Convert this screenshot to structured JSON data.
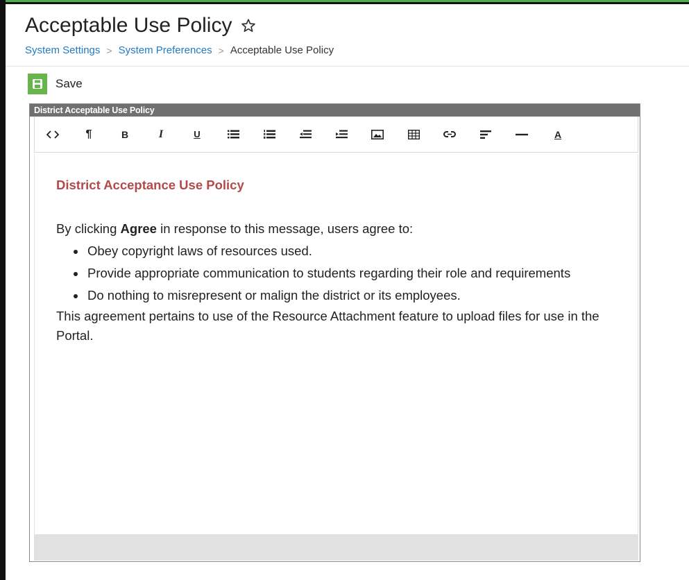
{
  "page": {
    "title": "Acceptable Use Policy"
  },
  "breadcrumb": {
    "items": [
      "System Settings",
      "System Preferences"
    ],
    "current": "Acceptable Use Policy"
  },
  "toolbar": {
    "save_label": "Save"
  },
  "editor": {
    "header": "District Acceptable Use Policy",
    "tools": [
      "code-view",
      "paragraph",
      "bold",
      "italic",
      "underline",
      "bullet-list",
      "numbered-list",
      "outdent",
      "indent",
      "image",
      "table",
      "link",
      "align",
      "horizontal-rule",
      "font-color"
    ],
    "tool_glyphs": {
      "paragraph": "¶",
      "bold": "B",
      "italic": "I",
      "underline": "U",
      "font_color": "A"
    }
  },
  "content": {
    "heading": "District Acceptance Use Policy",
    "intro_before": "By clicking ",
    "intro_bold": "Agree",
    "intro_after": " in response to this message, users agree to:",
    "bullets": [
      "Obey copyright laws of resources used.",
      "Provide appropriate communication to students regarding their role and requirements",
      "Do nothing to misrepresent or malign the district or its employees."
    ],
    "closing": "This agreement pertains to use of the Resource Attachment feature to upload files for use in the Portal."
  },
  "colors": {
    "save_green": "#68b44d",
    "link_blue": "#1f7bc4",
    "heading_red": "#b24a4a",
    "header_gray": "#707070"
  }
}
